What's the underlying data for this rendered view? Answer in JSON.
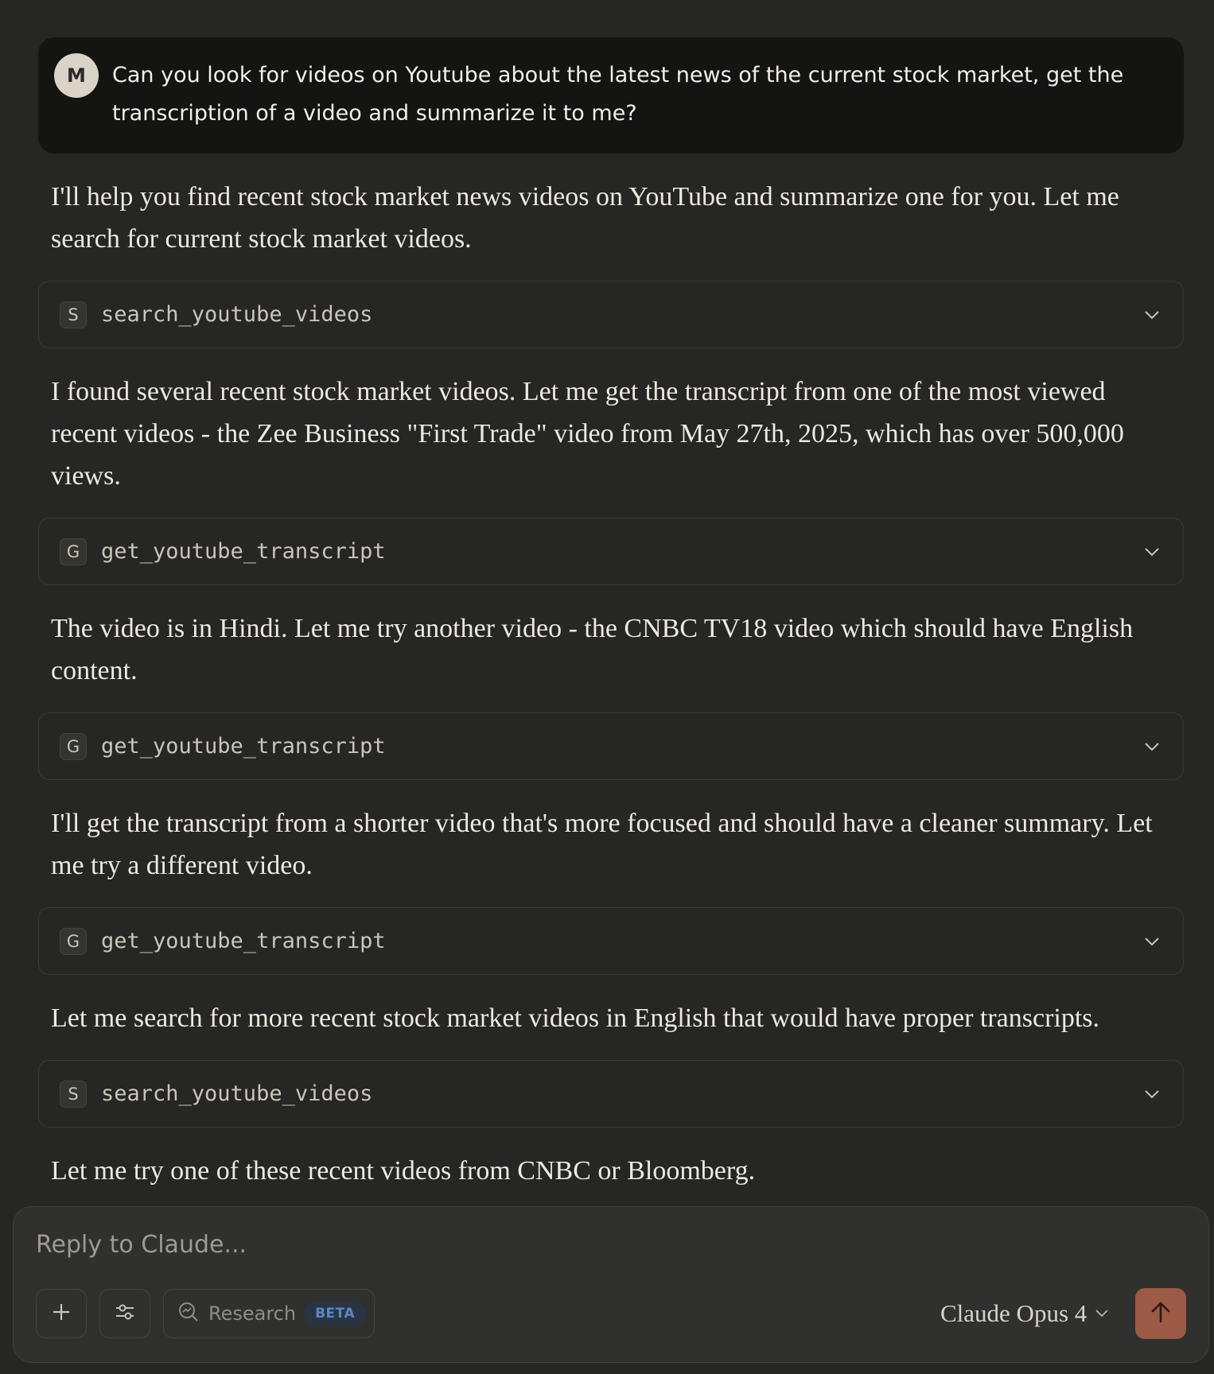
{
  "user_message": {
    "avatar_initial": "M",
    "text": "Can you look for videos on Youtube about the latest news of the current stock market, get the transcription of a video and summarize it to me?"
  },
  "assistant": {
    "text_1": "I'll help you find recent stock market news videos on YouTube and summarize one for you. Let me search for current stock market videos.",
    "tool_1": {
      "badge": "S",
      "name": "search_youtube_videos",
      "icon": "chevron-down-icon"
    },
    "text_2": "I found several recent stock market videos. Let me get the transcript from one of the most viewed recent videos - the Zee Business \"First Trade\" video from May 27th, 2025, which has over 500,000 views.",
    "tool_2": {
      "badge": "G",
      "name": "get_youtube_transcript",
      "icon": "chevron-down-icon"
    },
    "text_3": "The video is in Hindi. Let me try another video - the CNBC TV18 video which should have English content.",
    "tool_3": {
      "badge": "G",
      "name": "get_youtube_transcript",
      "icon": "chevron-down-icon"
    },
    "text_4": "I'll get the transcript from a shorter video that's more focused and should have a cleaner summary. Let me try a different video.",
    "tool_4": {
      "badge": "G",
      "name": "get_youtube_transcript",
      "icon": "chevron-down-icon"
    },
    "text_5": "Let me search for more recent stock market videos in English that would have proper transcripts.",
    "tool_5": {
      "badge": "S",
      "name": "search_youtube_videos",
      "icon": "chevron-down-icon"
    },
    "text_6": "Let me try one of these recent videos from CNBC or Bloomberg."
  },
  "composer": {
    "placeholder": "Reply to Claude...",
    "research_label": "Research",
    "beta_label": "BETA",
    "model_label": "Claude Opus 4",
    "icons": [
      "plus-icon",
      "sliders-icon",
      "research-search-icon",
      "chevron-down-icon",
      "arrow-up-icon"
    ]
  },
  "colors": {
    "background": "#262624",
    "user_bubble": "#141413",
    "send_button": "#9c5a47",
    "beta_text": "#5b87c9"
  }
}
